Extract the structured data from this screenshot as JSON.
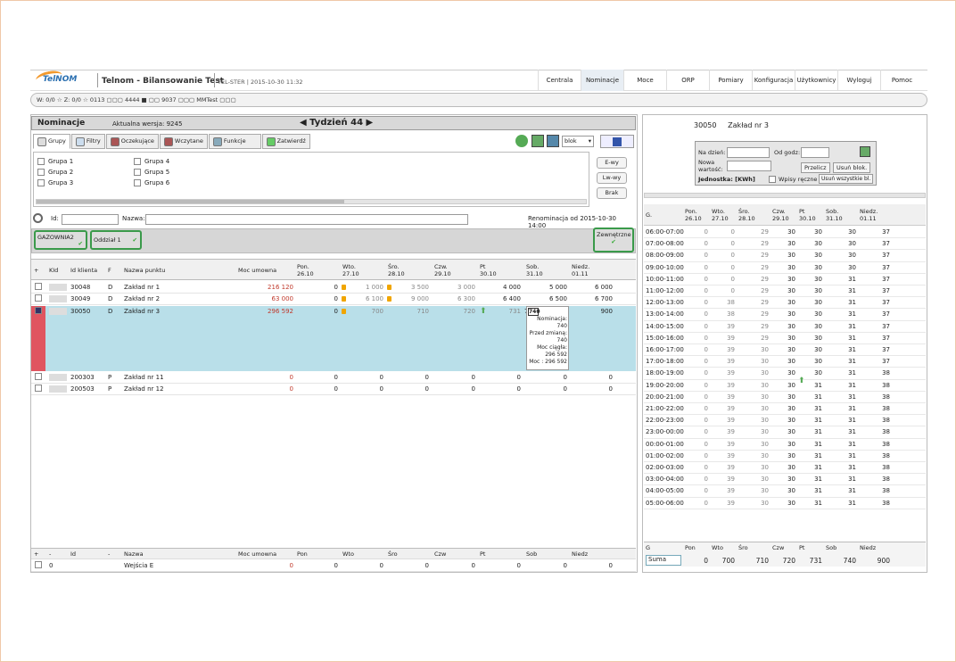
{
  "app": {
    "logo_text": "TelNOM",
    "title": "Telnom - Bilansowanie Test",
    "env": "TEL-STER",
    "datetime": "2015-10-30 11:32"
  },
  "nav": [
    "Centrala",
    "Nominacje",
    "Moce",
    "ORP",
    "Pomiary",
    "Konfiguracja",
    "Użytkownicy",
    "Wyloguj",
    "Pomoc"
  ],
  "status": "W: 0/0 ☆  Z: 0/0 ☆  0113 ▢▢▢  4444 ■ ▢▢  9037 ▢▢▢  MMTest ▢▢▢",
  "header": {
    "title": "Nominacje",
    "version": "Aktualna wersja: 9245",
    "week": "◀ Tydzień 44 ▶"
  },
  "tabs": [
    "Grupy",
    "Filtry",
    "Oczekujące",
    "Wczytane",
    "Funkcje",
    "Zatwierdź"
  ],
  "toolbar": {
    "blok": "blok"
  },
  "groups": [
    "Grupa 1",
    "Grupa 2",
    "Grupa 3",
    "Grupa 4",
    "Grupa 5",
    "Grupa 6"
  ],
  "side_buttons": [
    "E-wy",
    "Lw-wy",
    "Brak"
  ],
  "search": {
    "id_label": "Id:",
    "name_label": "Nazwa:",
    "renom": "Renominacja od 2015-10-30 14:00"
  },
  "strip": {
    "b1": "GAZOWNIA2",
    "b2": "Oddział 1",
    "b3": "Zewnętrzne"
  },
  "cols": {
    "plus": "+",
    "kid": "KId",
    "idk": "Id klienta",
    "f": "F",
    "name": "Nazwa punktu",
    "moc": "Moc umowna",
    "d1": "Pon.",
    "d1b": "26.10",
    "d2": "Wto.",
    "d2b": "27.10",
    "d3": "Śro.",
    "d3b": "28.10",
    "d4": "Czw.",
    "d4b": "29.10",
    "d5": "Pt",
    "d5b": "30.10",
    "d6": "Sob.",
    "d6b": "31.10",
    "d7": "Niedz.",
    "d7b": "01.11"
  },
  "rows": [
    {
      "id": "30048",
      "f": "D",
      "name": "Zakład nr 1",
      "moc": "216 120",
      "v": [
        "0",
        "1 000",
        "3 500",
        "3 000",
        "4 000",
        "5 000",
        "6 000"
      ]
    },
    {
      "id": "30049",
      "f": "D",
      "name": "Zakład nr 2",
      "moc": "63 000",
      "v": [
        "0",
        "6 100",
        "9 000",
        "6 300",
        "6 400",
        "6 500",
        "6 700"
      ]
    },
    {
      "id": "30050",
      "f": "D",
      "name": "Zakład nr 3",
      "moc": "296 592",
      "v": [
        "0",
        "700",
        "710",
        "720",
        "731",
        "740",
        "900"
      ]
    },
    {
      "id": "200303",
      "f": "P",
      "name": "Zakład nr 11",
      "moc": "0",
      "v": [
        "0",
        "0",
        "0",
        "0",
        "0",
        "0",
        "0"
      ]
    },
    {
      "id": "200503",
      "f": "P",
      "name": "Zakład nr 12",
      "moc": "0",
      "v": [
        "0",
        "0",
        "0",
        "0",
        "0",
        "0",
        "0"
      ]
    }
  ],
  "edit": {
    "value": "740",
    "l1": "Nominacja: 740",
    "l2": "Przed zmianą:",
    "l3": "740",
    "l4": "Moc ciągła:",
    "l5": "296 592",
    "l6": "Moc : 296 592"
  },
  "foot": {
    "cols": [
      "+",
      "-",
      "Id",
      "-",
      "Nazwa",
      "Moc umowna",
      "Pon",
      "Wto",
      "Śro",
      "Czw",
      "Pt",
      "Sob",
      "Niedz"
    ],
    "row": {
      "id": "0",
      "name": "Wejścia E",
      "moc": "0",
      "v": [
        "0",
        "0",
        "0",
        "0",
        "0",
        "0",
        "0"
      ]
    }
  },
  "right": {
    "id": "30050",
    "name": "Zakład nr 3",
    "filter": {
      "na_dzien": "Na dzień:",
      "od_godz": "Od godz:",
      "nowa": "Nowa wartość:",
      "przelicz": "Przelicz",
      "usun": "Usuń blok.",
      "jedn": "Jednostka: [KWh]",
      "wpisy": "Wpisy ręczne",
      "usun_all": "Usuń wszystkie bl."
    },
    "head": [
      "G.",
      "Pon.",
      "26.10",
      "Wto.",
      "27.10",
      "Śro.",
      "28.10",
      "Czw.",
      "29.10",
      "Pt",
      "30.10",
      "Sob.",
      "31.10",
      "Niedz.",
      "01.11"
    ],
    "hours": [
      [
        "06:00-07:00",
        "0",
        "0",
        "29",
        "30",
        "30",
        "30",
        "37"
      ],
      [
        "07:00-08:00",
        "0",
        "0",
        "29",
        "30",
        "30",
        "30",
        "37"
      ],
      [
        "08:00-09:00",
        "0",
        "0",
        "29",
        "30",
        "30",
        "30",
        "37"
      ],
      [
        "09:00-10:00",
        "0",
        "0",
        "29",
        "30",
        "30",
        "30",
        "37"
      ],
      [
        "10:00-11:00",
        "0",
        "0",
        "29",
        "30",
        "30",
        "31",
        "37"
      ],
      [
        "11:00-12:00",
        "0",
        "0",
        "29",
        "30",
        "30",
        "31",
        "37"
      ],
      [
        "12:00-13:00",
        "0",
        "38",
        "29",
        "30",
        "30",
        "31",
        "37"
      ],
      [
        "13:00-14:00",
        "0",
        "38",
        "29",
        "30",
        "30",
        "31",
        "37"
      ],
      [
        "14:00-15:00",
        "0",
        "39",
        "29",
        "30",
        "30",
        "31",
        "37"
      ],
      [
        "15:00-16:00",
        "0",
        "39",
        "29",
        "30",
        "30",
        "31",
        "37"
      ],
      [
        "16:00-17:00",
        "0",
        "39",
        "30",
        "30",
        "30",
        "31",
        "37"
      ],
      [
        "17:00-18:00",
        "0",
        "39",
        "30",
        "30",
        "30",
        "31",
        "37"
      ],
      [
        "18:00-19:00",
        "0",
        "39",
        "30",
        "30",
        "30",
        "31",
        "38"
      ],
      [
        "19:00-20:00",
        "0",
        "39",
        "30",
        "30",
        "31",
        "31",
        "38"
      ],
      [
        "20:00-21:00",
        "0",
        "39",
        "30",
        "30",
        "31",
        "31",
        "38"
      ],
      [
        "21:00-22:00",
        "0",
        "39",
        "30",
        "30",
        "31",
        "31",
        "38"
      ],
      [
        "22:00-23:00",
        "0",
        "39",
        "30",
        "30",
        "31",
        "31",
        "38"
      ],
      [
        "23:00-00:00",
        "0",
        "39",
        "30",
        "30",
        "31",
        "31",
        "38"
      ],
      [
        "00:00-01:00",
        "0",
        "39",
        "30",
        "30",
        "31",
        "31",
        "38"
      ],
      [
        "01:00-02:00",
        "0",
        "39",
        "30",
        "30",
        "31",
        "31",
        "38"
      ],
      [
        "02:00-03:00",
        "0",
        "39",
        "30",
        "30",
        "31",
        "31",
        "38"
      ],
      [
        "03:00-04:00",
        "0",
        "39",
        "30",
        "30",
        "31",
        "31",
        "38"
      ],
      [
        "04:00-05:00",
        "0",
        "39",
        "30",
        "30",
        "31",
        "31",
        "38"
      ],
      [
        "05:00-06:00",
        "0",
        "39",
        "30",
        "30",
        "31",
        "31",
        "38"
      ]
    ],
    "foot_head": [
      "G",
      "Pon",
      "Wto",
      "Śro",
      "Czw",
      "Pt",
      "Sob",
      "Niedz"
    ],
    "sum": [
      "Suma",
      "0",
      "700",
      "710",
      "720",
      "731",
      "740",
      "900"
    ]
  }
}
